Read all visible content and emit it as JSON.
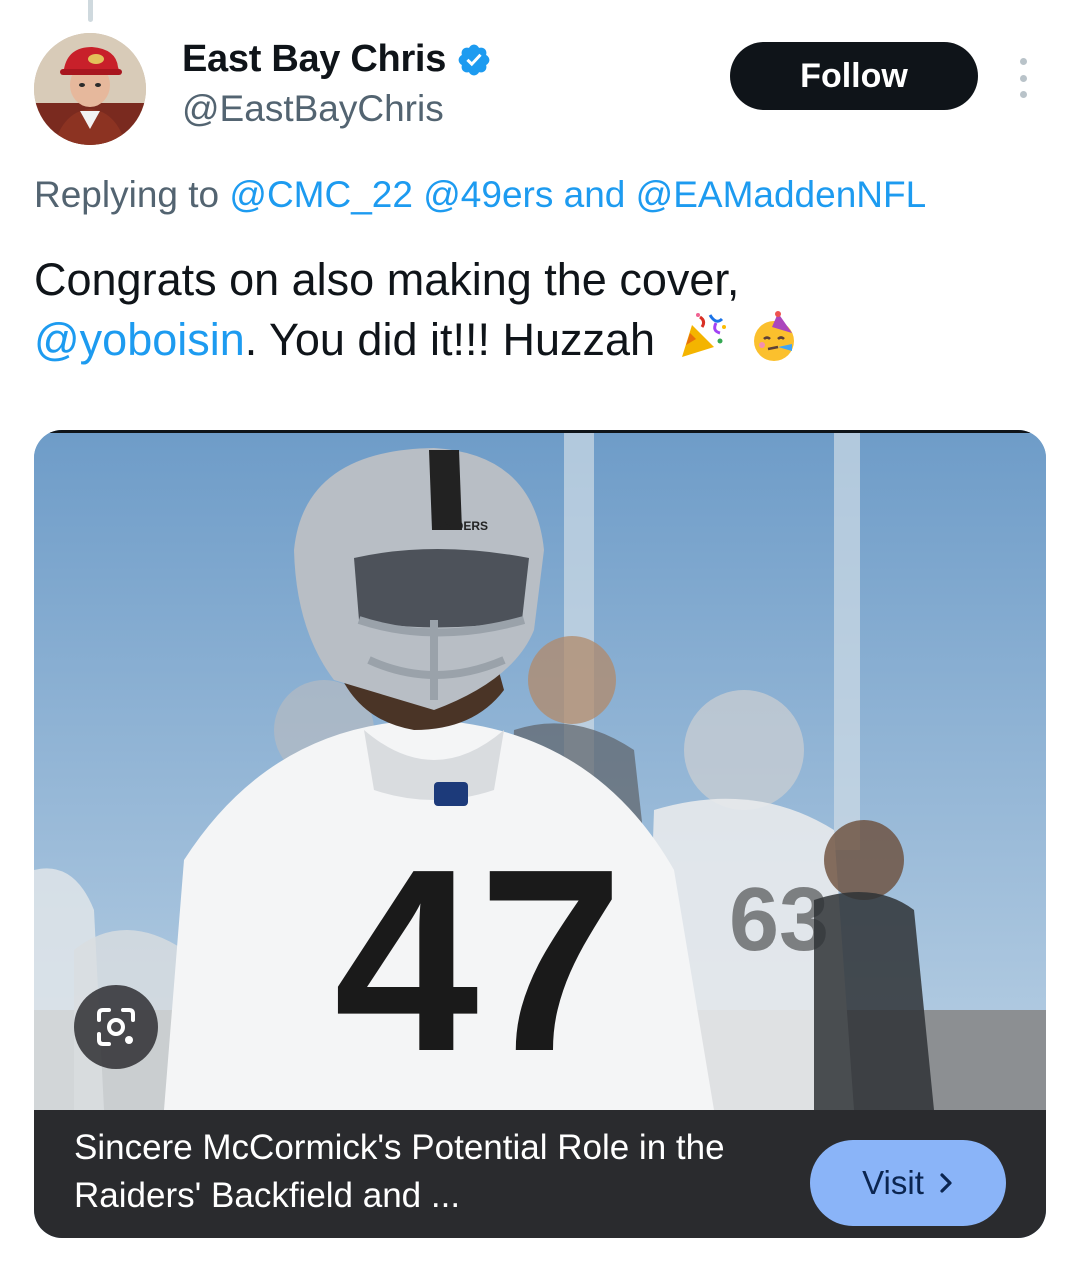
{
  "author": {
    "display_name": "East Bay Chris",
    "handle": "@EastBayChris",
    "verified": true,
    "avatar_icon": "profile-photo-icon"
  },
  "actions": {
    "follow_label": "Follow",
    "more_icon": "more-vertical-icon"
  },
  "reply": {
    "prefix": "Replying to",
    "mentions": [
      "@CMC_22",
      "@49ers"
    ],
    "joiner": "and",
    "last_mention": "@EAMaddenNFL"
  },
  "tweet": {
    "line1": "Congrats on also making the cover,",
    "mention": "@yoboisin",
    "line2": ". You did it!!! Huzzah",
    "emojis": [
      "party-popper-icon",
      "partying-face-icon"
    ]
  },
  "link_card": {
    "image_icon": "raiders-player-photo",
    "lens_icon": "google-lens-icon",
    "title": "Sincere McCormick's Potential Role in the Raiders' Backfield and ...",
    "visit_label": "Visit",
    "visit_icon": "chevron-right-icon"
  },
  "colors": {
    "accent": "#1d9bf0",
    "text_primary": "#0f1419",
    "text_secondary": "#536471",
    "follow_bg": "#0f1419",
    "card_footer_bg": "#2a2b2e",
    "visit_bg": "#8ab4f8"
  }
}
